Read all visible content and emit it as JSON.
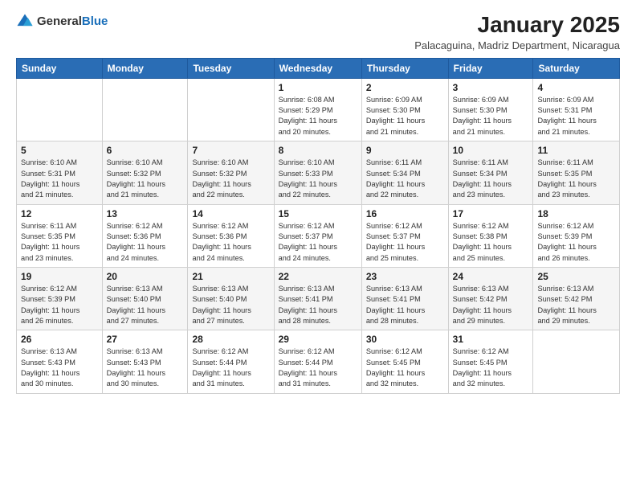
{
  "logo": {
    "general": "General",
    "blue": "Blue"
  },
  "header": {
    "month": "January 2025",
    "location": "Palacaguina, Madriz Department, Nicaragua"
  },
  "weekdays": [
    "Sunday",
    "Monday",
    "Tuesday",
    "Wednesday",
    "Thursday",
    "Friday",
    "Saturday"
  ],
  "weeks": [
    [
      {
        "day": "",
        "info": ""
      },
      {
        "day": "",
        "info": ""
      },
      {
        "day": "",
        "info": ""
      },
      {
        "day": "1",
        "info": "Sunrise: 6:08 AM\nSunset: 5:29 PM\nDaylight: 11 hours\nand 20 minutes."
      },
      {
        "day": "2",
        "info": "Sunrise: 6:09 AM\nSunset: 5:30 PM\nDaylight: 11 hours\nand 21 minutes."
      },
      {
        "day": "3",
        "info": "Sunrise: 6:09 AM\nSunset: 5:30 PM\nDaylight: 11 hours\nand 21 minutes."
      },
      {
        "day": "4",
        "info": "Sunrise: 6:09 AM\nSunset: 5:31 PM\nDaylight: 11 hours\nand 21 minutes."
      }
    ],
    [
      {
        "day": "5",
        "info": "Sunrise: 6:10 AM\nSunset: 5:31 PM\nDaylight: 11 hours\nand 21 minutes."
      },
      {
        "day": "6",
        "info": "Sunrise: 6:10 AM\nSunset: 5:32 PM\nDaylight: 11 hours\nand 21 minutes."
      },
      {
        "day": "7",
        "info": "Sunrise: 6:10 AM\nSunset: 5:32 PM\nDaylight: 11 hours\nand 22 minutes."
      },
      {
        "day": "8",
        "info": "Sunrise: 6:10 AM\nSunset: 5:33 PM\nDaylight: 11 hours\nand 22 minutes."
      },
      {
        "day": "9",
        "info": "Sunrise: 6:11 AM\nSunset: 5:34 PM\nDaylight: 11 hours\nand 22 minutes."
      },
      {
        "day": "10",
        "info": "Sunrise: 6:11 AM\nSunset: 5:34 PM\nDaylight: 11 hours\nand 23 minutes."
      },
      {
        "day": "11",
        "info": "Sunrise: 6:11 AM\nSunset: 5:35 PM\nDaylight: 11 hours\nand 23 minutes."
      }
    ],
    [
      {
        "day": "12",
        "info": "Sunrise: 6:11 AM\nSunset: 5:35 PM\nDaylight: 11 hours\nand 23 minutes."
      },
      {
        "day": "13",
        "info": "Sunrise: 6:12 AM\nSunset: 5:36 PM\nDaylight: 11 hours\nand 24 minutes."
      },
      {
        "day": "14",
        "info": "Sunrise: 6:12 AM\nSunset: 5:36 PM\nDaylight: 11 hours\nand 24 minutes."
      },
      {
        "day": "15",
        "info": "Sunrise: 6:12 AM\nSunset: 5:37 PM\nDaylight: 11 hours\nand 24 minutes."
      },
      {
        "day": "16",
        "info": "Sunrise: 6:12 AM\nSunset: 5:37 PM\nDaylight: 11 hours\nand 25 minutes."
      },
      {
        "day": "17",
        "info": "Sunrise: 6:12 AM\nSunset: 5:38 PM\nDaylight: 11 hours\nand 25 minutes."
      },
      {
        "day": "18",
        "info": "Sunrise: 6:12 AM\nSunset: 5:39 PM\nDaylight: 11 hours\nand 26 minutes."
      }
    ],
    [
      {
        "day": "19",
        "info": "Sunrise: 6:12 AM\nSunset: 5:39 PM\nDaylight: 11 hours\nand 26 minutes."
      },
      {
        "day": "20",
        "info": "Sunrise: 6:13 AM\nSunset: 5:40 PM\nDaylight: 11 hours\nand 27 minutes."
      },
      {
        "day": "21",
        "info": "Sunrise: 6:13 AM\nSunset: 5:40 PM\nDaylight: 11 hours\nand 27 minutes."
      },
      {
        "day": "22",
        "info": "Sunrise: 6:13 AM\nSunset: 5:41 PM\nDaylight: 11 hours\nand 28 minutes."
      },
      {
        "day": "23",
        "info": "Sunrise: 6:13 AM\nSunset: 5:41 PM\nDaylight: 11 hours\nand 28 minutes."
      },
      {
        "day": "24",
        "info": "Sunrise: 6:13 AM\nSunset: 5:42 PM\nDaylight: 11 hours\nand 29 minutes."
      },
      {
        "day": "25",
        "info": "Sunrise: 6:13 AM\nSunset: 5:42 PM\nDaylight: 11 hours\nand 29 minutes."
      }
    ],
    [
      {
        "day": "26",
        "info": "Sunrise: 6:13 AM\nSunset: 5:43 PM\nDaylight: 11 hours\nand 30 minutes."
      },
      {
        "day": "27",
        "info": "Sunrise: 6:13 AM\nSunset: 5:43 PM\nDaylight: 11 hours\nand 30 minutes."
      },
      {
        "day": "28",
        "info": "Sunrise: 6:12 AM\nSunset: 5:44 PM\nDaylight: 11 hours\nand 31 minutes."
      },
      {
        "day": "29",
        "info": "Sunrise: 6:12 AM\nSunset: 5:44 PM\nDaylight: 11 hours\nand 31 minutes."
      },
      {
        "day": "30",
        "info": "Sunrise: 6:12 AM\nSunset: 5:45 PM\nDaylight: 11 hours\nand 32 minutes."
      },
      {
        "day": "31",
        "info": "Sunrise: 6:12 AM\nSunset: 5:45 PM\nDaylight: 11 hours\nand 32 minutes."
      },
      {
        "day": "",
        "info": ""
      }
    ]
  ]
}
